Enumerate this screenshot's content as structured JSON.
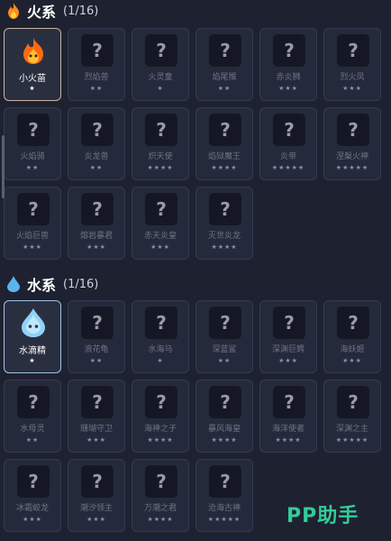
{
  "fire": {
    "title": "火系",
    "count": "(1/16)",
    "items": [
      {
        "name": "小火苗",
        "stars": "★",
        "active": true
      },
      {
        "name": "烈焰兽",
        "stars": "★★",
        "active": false
      },
      {
        "name": "火灵童",
        "stars": "★",
        "active": false
      },
      {
        "name": "焰尾猴",
        "stars": "★★",
        "active": false
      },
      {
        "name": "赤炎狮",
        "stars": "★★★",
        "active": false
      },
      {
        "name": "烈火凤",
        "stars": "★★★",
        "active": false
      },
      {
        "name": "火焰骑",
        "stars": "★★",
        "active": false
      },
      {
        "name": "炎龙兽",
        "stars": "★★",
        "active": false
      },
      {
        "name": "炽天使",
        "stars": "★★★★",
        "active": false
      },
      {
        "name": "焰狱魔王",
        "stars": "★★★★",
        "active": false
      },
      {
        "name": "炎帝",
        "stars": "★★★★★",
        "active": false
      },
      {
        "name": "涅槃火神",
        "stars": "★★★★★",
        "active": false
      },
      {
        "name": "火焰巨兽",
        "stars": "★★★",
        "active": false
      },
      {
        "name": "熔岩暴君",
        "stars": "★★★",
        "active": false
      },
      {
        "name": "赤天炎皇",
        "stars": "★★★",
        "active": false
      },
      {
        "name": "灭世炎龙",
        "stars": "★★★★",
        "active": false
      }
    ]
  },
  "water": {
    "title": "水系",
    "count": "(1/16)",
    "items": [
      {
        "name": "水滴精",
        "stars": "★",
        "active": true
      },
      {
        "name": "浪花龟",
        "stars": "★★",
        "active": false
      },
      {
        "name": "水海马",
        "stars": "★",
        "active": false
      },
      {
        "name": "深蓝鲨",
        "stars": "★★",
        "active": false
      },
      {
        "name": "深渊巨鳄",
        "stars": "★★★",
        "active": false
      },
      {
        "name": "海妖姬",
        "stars": "★★★",
        "active": false
      },
      {
        "name": "水母灵",
        "stars": "★★",
        "active": false
      },
      {
        "name": "珊瑚守卫",
        "stars": "★★★",
        "active": false
      },
      {
        "name": "海神之子",
        "stars": "★★★★",
        "active": false
      },
      {
        "name": "暴风海皇",
        "stars": "★★★★",
        "active": false
      },
      {
        "name": "海洋使者",
        "stars": "★★★★",
        "active": false
      },
      {
        "name": "深渊之主",
        "stars": "★★★★★",
        "active": false
      },
      {
        "name": "冰霜蛟龙",
        "stars": "★★★",
        "active": false
      },
      {
        "name": "潮汐领主",
        "stars": "★★★",
        "active": false
      },
      {
        "name": "万潮之君",
        "stars": "★★★★",
        "active": false
      },
      {
        "name": "沧海古神",
        "stars": "★★★★★",
        "active": false
      }
    ]
  },
  "watermark": "PP助手",
  "icons": {
    "fire": "flame-icon",
    "water": "water-drop-icon",
    "unknown": "question-mark"
  }
}
